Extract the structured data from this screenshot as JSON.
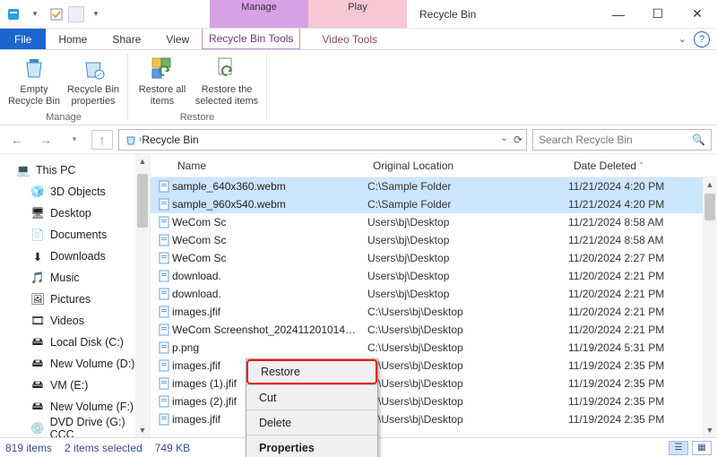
{
  "window": {
    "title": "Recycle Bin",
    "context_tabs": {
      "manage": "Manage",
      "play": "Play"
    }
  },
  "ribbon_tabs": {
    "file": "File",
    "home": "Home",
    "share": "Share",
    "view": "View",
    "tools": "Recycle Bin Tools",
    "video": "Video Tools"
  },
  "ribbon": {
    "empty": "Empty Recycle Bin",
    "props": "Recycle Bin properties",
    "restore_all": "Restore all items",
    "restore_sel": "Restore the selected items",
    "group_manage": "Manage",
    "group_restore": "Restore"
  },
  "address": {
    "crumb": "Recycle Bin",
    "search_placeholder": "Search Recycle Bin"
  },
  "nav": {
    "thispc": "This PC",
    "objects3d": "3D Objects",
    "desktop": "Desktop",
    "documents": "Documents",
    "downloads": "Downloads",
    "music": "Music",
    "pictures": "Pictures",
    "videos": "Videos",
    "localc": "Local Disk (C:)",
    "newvold": "New Volume (D:)",
    "vme": "VM (E:)",
    "newvolf": "New Volume (F:)",
    "dvd": "DVD Drive (G:) CCC"
  },
  "columns": {
    "name": "Name",
    "loc": "Original Location",
    "date": "Date Deleted"
  },
  "rows": [
    {
      "name": "sample_640x360.webm",
      "loc": "C:\\Sample Folder",
      "date": "11/21/2024 4:20 PM",
      "selected": true
    },
    {
      "name": "sample_960x540.webm",
      "loc": "C:\\Sample Folder",
      "date": "11/21/2024 4:20 PM",
      "selected": true
    },
    {
      "name": "WeCom Sc",
      "loc": "Users\\bj\\Desktop",
      "date": "11/21/2024 8:58 AM",
      "selected": false
    },
    {
      "name": "WeCom Sc",
      "loc": "Users\\bj\\Desktop",
      "date": "11/21/2024 8:58 AM",
      "selected": false
    },
    {
      "name": "WeCom Sc",
      "loc": "Users\\bj\\Desktop",
      "date": "11/20/2024 2:27 PM",
      "selected": false
    },
    {
      "name": "download.",
      "loc": "Users\\bj\\Desktop",
      "date": "11/20/2024 2:21 PM",
      "selected": false
    },
    {
      "name": "download.",
      "loc": "Users\\bj\\Desktop",
      "date": "11/20/2024 2:21 PM",
      "selected": false
    },
    {
      "name": "images.jfif",
      "loc": "C:\\Users\\bj\\Desktop",
      "date": "11/20/2024 2:21 PM",
      "selected": false
    },
    {
      "name": "WeCom Screenshot_202411201014…",
      "loc": "C:\\Users\\bj\\Desktop",
      "date": "11/20/2024 2:21 PM",
      "selected": false
    },
    {
      "name": "p.png",
      "loc": "C:\\Users\\bj\\Desktop",
      "date": "11/19/2024 5:31 PM",
      "selected": false
    },
    {
      "name": "images.jfif",
      "loc": "C:\\Users\\bj\\Desktop",
      "date": "11/19/2024 2:35 PM",
      "selected": false
    },
    {
      "name": "images (1).jfif",
      "loc": "C:\\Users\\bj\\Desktop",
      "date": "11/19/2024 2:35 PM",
      "selected": false
    },
    {
      "name": "images (2).jfif",
      "loc": "C:\\Users\\bj\\Desktop",
      "date": "11/19/2024 2:35 PM",
      "selected": false
    },
    {
      "name": "images.jfif",
      "loc": "C:\\Users\\bj\\Desktop",
      "date": "11/19/2024 2:35 PM",
      "selected": false
    }
  ],
  "context_menu": {
    "restore": "Restore",
    "cut": "Cut",
    "delete": "Delete",
    "properties": "Properties"
  },
  "status": {
    "items": "819 items",
    "selected": "2 items selected",
    "size": "749 KB"
  }
}
